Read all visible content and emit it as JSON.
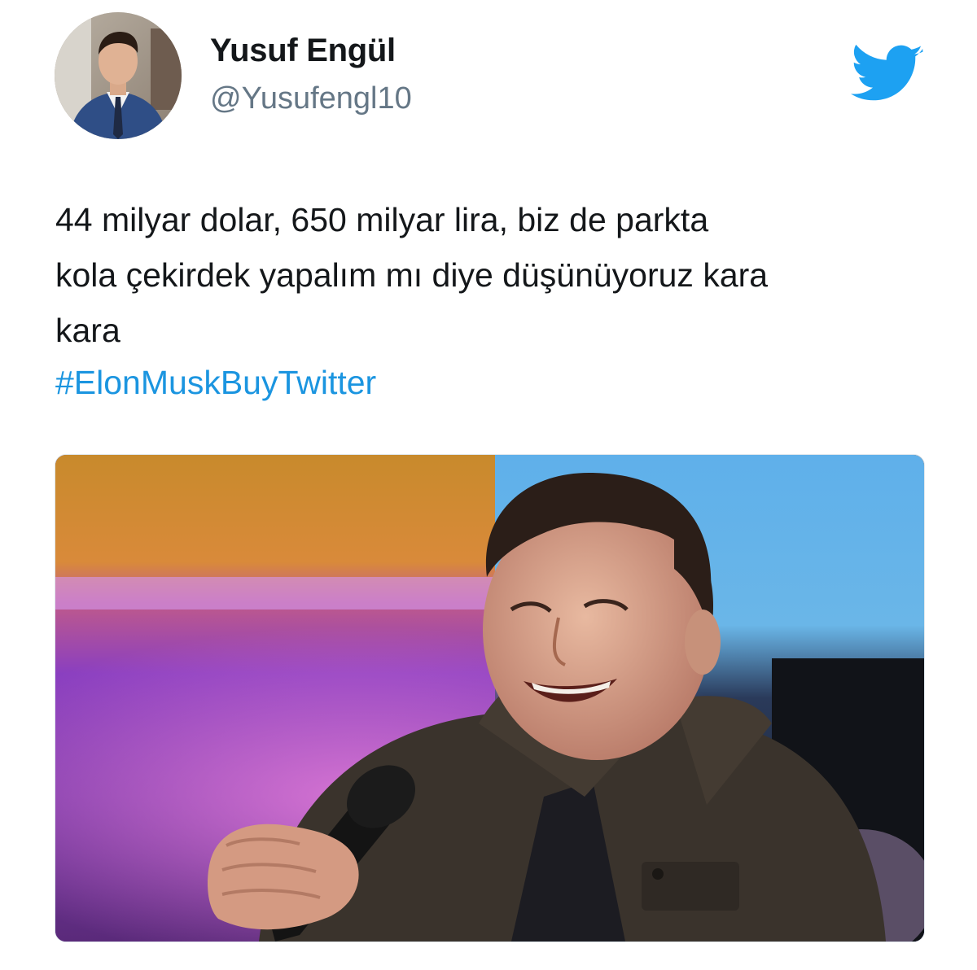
{
  "user": {
    "display_name": "Yusuf Engül",
    "handle": "@Yusufengl10"
  },
  "brand": {
    "logo_icon": "twitter-bird-icon",
    "accent_color": "#1da1f2"
  },
  "tweet": {
    "text_lines": [
      "44 milyar dolar, 650 milyar lira, biz de parkta",
      "kola çekirdek yapalım mı diye düşünüyoruz kara",
      "kara"
    ],
    "hashtag": "#ElonMuskBuyTwitter",
    "hashtag_color": "#1b95e0"
  },
  "media": {
    "type": "photo",
    "subject": "man-with-microphone-photo"
  }
}
